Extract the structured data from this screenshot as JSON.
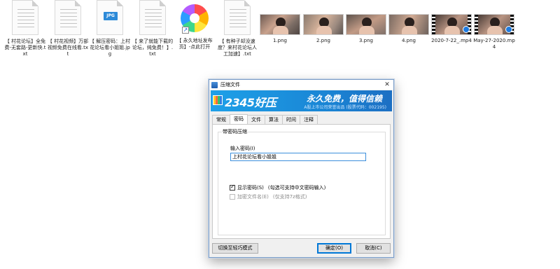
{
  "desktop": {
    "files": [
      {
        "caption": "【 村花论坛】全免费-无套路-更新快.txt",
        "type": "txt"
      },
      {
        "caption": "【 村花视频】万部视频免费在线看.txt",
        "type": "txt"
      },
      {
        "caption": "【 解压密码：上村花论坛看小姐姐.jpg",
        "type": "jpg",
        "badge": "JPG"
      },
      {
        "caption": "【 来了就能下载的论坛，纯免费！】.txt",
        "type": "txt"
      },
      {
        "caption": "【 永久地址发布页】-点此打开",
        "type": "url"
      },
      {
        "caption": "【 有种子却没速度？来村花论坛人工加速】.txt",
        "type": "txt"
      }
    ],
    "media": [
      {
        "caption": "1.png",
        "kind": "image"
      },
      {
        "caption": "2.png",
        "kind": "image"
      },
      {
        "caption": "3.png",
        "kind": "image"
      },
      {
        "caption": "4.png",
        "kind": "image"
      },
      {
        "caption": "2020-7-22_.mp4",
        "kind": "video"
      },
      {
        "caption": "May-27-2020.mp4",
        "kind": "video"
      }
    ]
  },
  "dialog": {
    "title": "压缩文件",
    "close_glyph": "✕",
    "banner": {
      "brand": "2345好压",
      "slogan": "永久免费，值得信赖",
      "subline": "A股上市公司荣誉出品 (股票代码：002195)"
    },
    "tabs": [
      "常规",
      "密码",
      "文件",
      "算法",
      "时间",
      "注释"
    ],
    "active_tab": "密码",
    "group_label": "带密码压缩",
    "password_label": "输入密码(I)",
    "password_value": "上村花论坛看小姐姐",
    "show_password": {
      "label": "显示密码(S)",
      "note": "(勾选可支持中文密码输入)",
      "checked": true
    },
    "encrypt_names": {
      "label": "加密文件名(E)",
      "note": "(仅支持7z格式)",
      "checked": false,
      "disabled": true
    },
    "buttons": {
      "simple_mode": "切换至轻巧模式",
      "ok": "确定(O)",
      "cancel": "取消(C)"
    }
  },
  "colors": {
    "banner_start": "#1ea0e8",
    "banner_end": "#1c6fc3",
    "focus_border": "#3c8fdc"
  }
}
